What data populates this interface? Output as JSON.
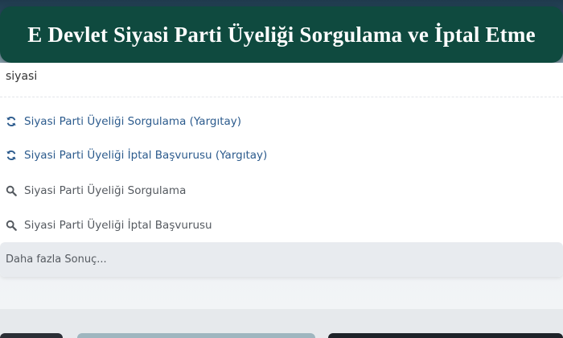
{
  "banner": {
    "title": "E Devlet Siyasi Parti Üyeliği Sorgulama ve İptal Etme"
  },
  "search": {
    "value": "siyasi"
  },
  "results": [
    {
      "label": "Siyasi Parti Üyeliği Sorgulama (Yargıtay)",
      "icon": "refresh-icon"
    },
    {
      "label": "Siyasi Parti Üyeliği İptal Başvurusu (Yargıtay)",
      "icon": "refresh-icon"
    },
    {
      "label": "Siyasi Parti Üyeliği Sorgulama",
      "icon": "search-icon"
    },
    {
      "label": "Siyasi Parti Üyeliği İptal Başvurusu",
      "icon": "search-icon"
    }
  ],
  "more": {
    "label": "Daha fazla Sonuç..."
  },
  "colors": {
    "banner": "#0f4a3f",
    "link": "#2c5b8d",
    "text": "#555a60"
  }
}
